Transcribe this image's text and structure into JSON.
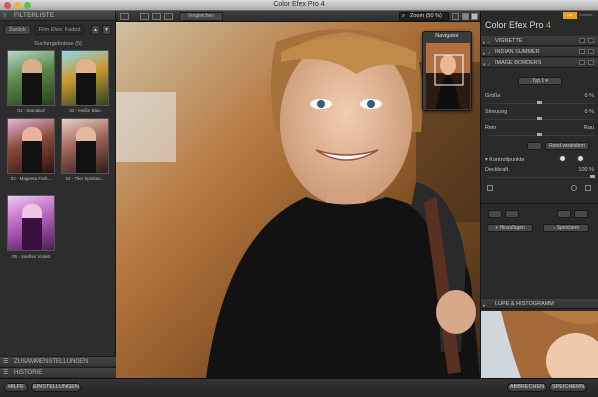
{
  "window": {
    "title": "Color Efex Pro 4"
  },
  "left_panel": {
    "filter_list_header": "FILTERLISTE",
    "tabs": [
      "Zurück",
      "Film Efex: Faded"
    ],
    "search_results": "Suchergebnisse (5)",
    "thumbnails": [
      {
        "label": "01 - Standard"
      },
      {
        "label": "02 - Heiße Blau"
      },
      {
        "label": "03 - Magenta Farb..."
      },
      {
        "label": "04 - Tiler Spieltau..."
      },
      {
        "label": "05 - Sanftes Violett"
      }
    ],
    "collections": "ZUSAMMENSTELLUNGEN",
    "history": "HISTORIE"
  },
  "toolbar": {
    "compare_label": "Vergleichen",
    "zoom_label": "Zoom (50 %)"
  },
  "navigator": {
    "title": "Navigator"
  },
  "right_panel": {
    "app_name": "Color Efex Pro",
    "app_version": "4",
    "logo_text": "NIK",
    "logo_caption": "Software",
    "filters": [
      {
        "name": "VIGNETTE"
      },
      {
        "name": "INDIAN SUMMER"
      },
      {
        "name": "IMAGE BORDERS"
      }
    ],
    "type_select": "Typ 1",
    "controls": [
      {
        "label": "Größe",
        "value": "0 %"
      },
      {
        "label": "Streuung",
        "value": "0 %"
      },
      {
        "label": "Rein",
        "value": "Rau"
      }
    ],
    "random_button": "Rand verändern",
    "control_points": "Kontrollpunkte",
    "opacity_label": "Deckkraft",
    "opacity_value": "100 %",
    "add_button": "Hinzufügen",
    "save_button": "Speichern",
    "loupe_header": "LUPE & HISTOGRAMM"
  },
  "bottom_bar": {
    "help": "HILFE",
    "settings": "EINSTELLUNGEN",
    "cancel": "ABBRECHEN",
    "save": "SPEICHERN"
  },
  "colors": {
    "accent": "#f0a028"
  }
}
